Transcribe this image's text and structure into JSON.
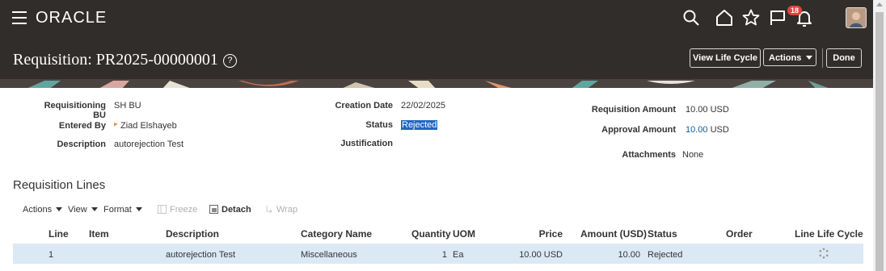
{
  "header": {
    "logo": "ORACLE",
    "notification_count": "18",
    "icons": [
      "menu-icon",
      "search-icon",
      "home-icon",
      "star-icon",
      "flag-icon",
      "bell-icon"
    ]
  },
  "page": {
    "title": "Requisition: PR2025-00000001",
    "help_glyph": "?",
    "buttons": {
      "view_life_cycle": "View Life Cycle",
      "actions": "Actions",
      "done": "Done"
    }
  },
  "details": {
    "requisitioning_bu_label_1": "Requisitioning",
    "requisitioning_bu_label_2": "BU",
    "requisitioning_bu": "SH BU",
    "entered_by_label": "Entered By",
    "entered_by": "Ziad Elshayeb",
    "description_label": "Description",
    "description": "autorejection Test",
    "creation_date_label": "Creation Date",
    "creation_date": "22/02/2025",
    "status_label": "Status",
    "status": "Rejected",
    "justification_label": "Justification",
    "requisition_amount_label": "Requisition Amount",
    "requisition_amount": "10.00",
    "requisition_currency": "USD",
    "approval_amount_label": "Approval Amount",
    "approval_amount": "10.00",
    "approval_currency": "USD",
    "attachments_label": "Attachments",
    "attachments": "None"
  },
  "lines": {
    "section_title": "Requisition Lines",
    "toolbar": {
      "actions": "Actions",
      "view": "View",
      "format": "Format",
      "freeze": "Freeze",
      "detach": "Detach",
      "wrap": "Wrap"
    },
    "columns": {
      "line": "Line",
      "item": "Item",
      "description": "Description",
      "category": "Category Name",
      "quantity": "Quantity",
      "uom": "UOM",
      "price": "Price",
      "amount": "Amount (USD)",
      "status": "Status",
      "order": "Order",
      "life_cycle": "Line Life Cycle"
    },
    "rows": [
      {
        "line": "1",
        "item": "",
        "description": "autorejection Test",
        "category": "Miscellaneous",
        "quantity": "1",
        "uom": "Ea",
        "price": "10.00 USD",
        "amount": "10.00",
        "status": "Rejected",
        "order": ""
      }
    ]
  },
  "colors": {
    "header_bg": "#312d2a",
    "link": "#0e5d96",
    "selected_row": "#dbe9f5",
    "status_highlight": "#2165c4"
  }
}
